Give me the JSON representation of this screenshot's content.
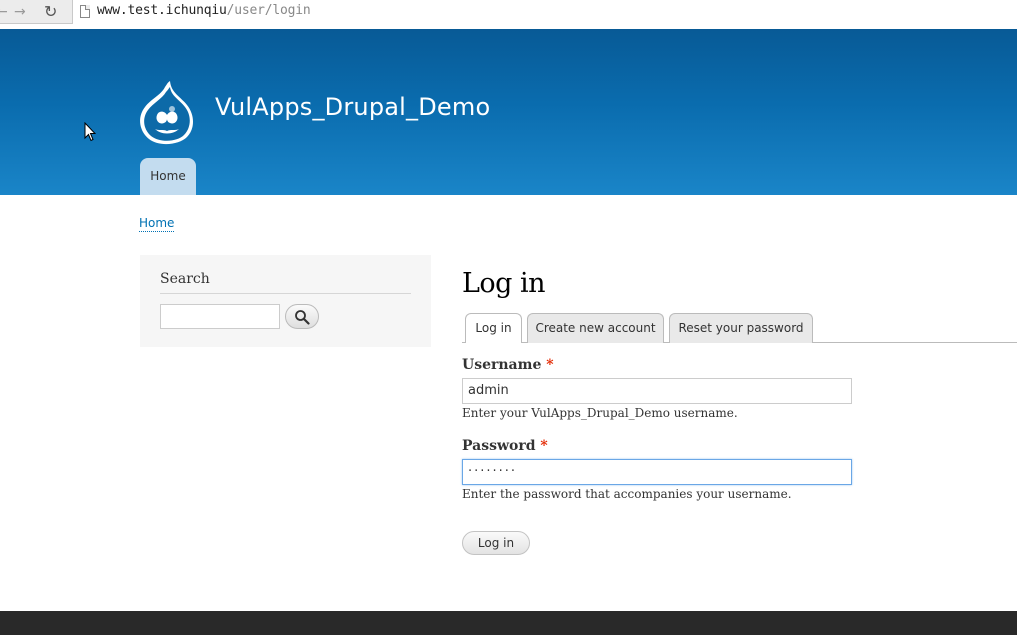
{
  "browser": {
    "nav_back": "←",
    "nav_forward": "→",
    "nav_reload": "↻",
    "url_host": "www.test.ichunqiu",
    "url_path": "/user/login"
  },
  "header": {
    "site_name": "VulApps_Drupal_Demo",
    "nav_home": "Home",
    "logo_icon": "drupal-drop-logo"
  },
  "breadcrumb": {
    "home": "Home"
  },
  "sidebar": {
    "search_title": "Search",
    "search_value": "",
    "search_icon": "magnifier-icon"
  },
  "main": {
    "title": "Log in",
    "tabs": [
      {
        "label": "Log in",
        "active": true
      },
      {
        "label": "Create new account",
        "active": false
      },
      {
        "label": "Reset your password",
        "active": false
      }
    ],
    "username": {
      "label": "Username",
      "required_mark": "*",
      "value": "admin",
      "description": "Enter your VulApps_Drupal_Demo username."
    },
    "password": {
      "label": "Password",
      "required_mark": "*",
      "value": "········",
      "description": "Enter the password that accompanies your username."
    },
    "submit_label": "Log in"
  },
  "colors": {
    "header_top": "#085a96",
    "header_bottom": "#1a85c8",
    "link": "#0071b3",
    "required": "#e32700",
    "footer": "#292929"
  }
}
